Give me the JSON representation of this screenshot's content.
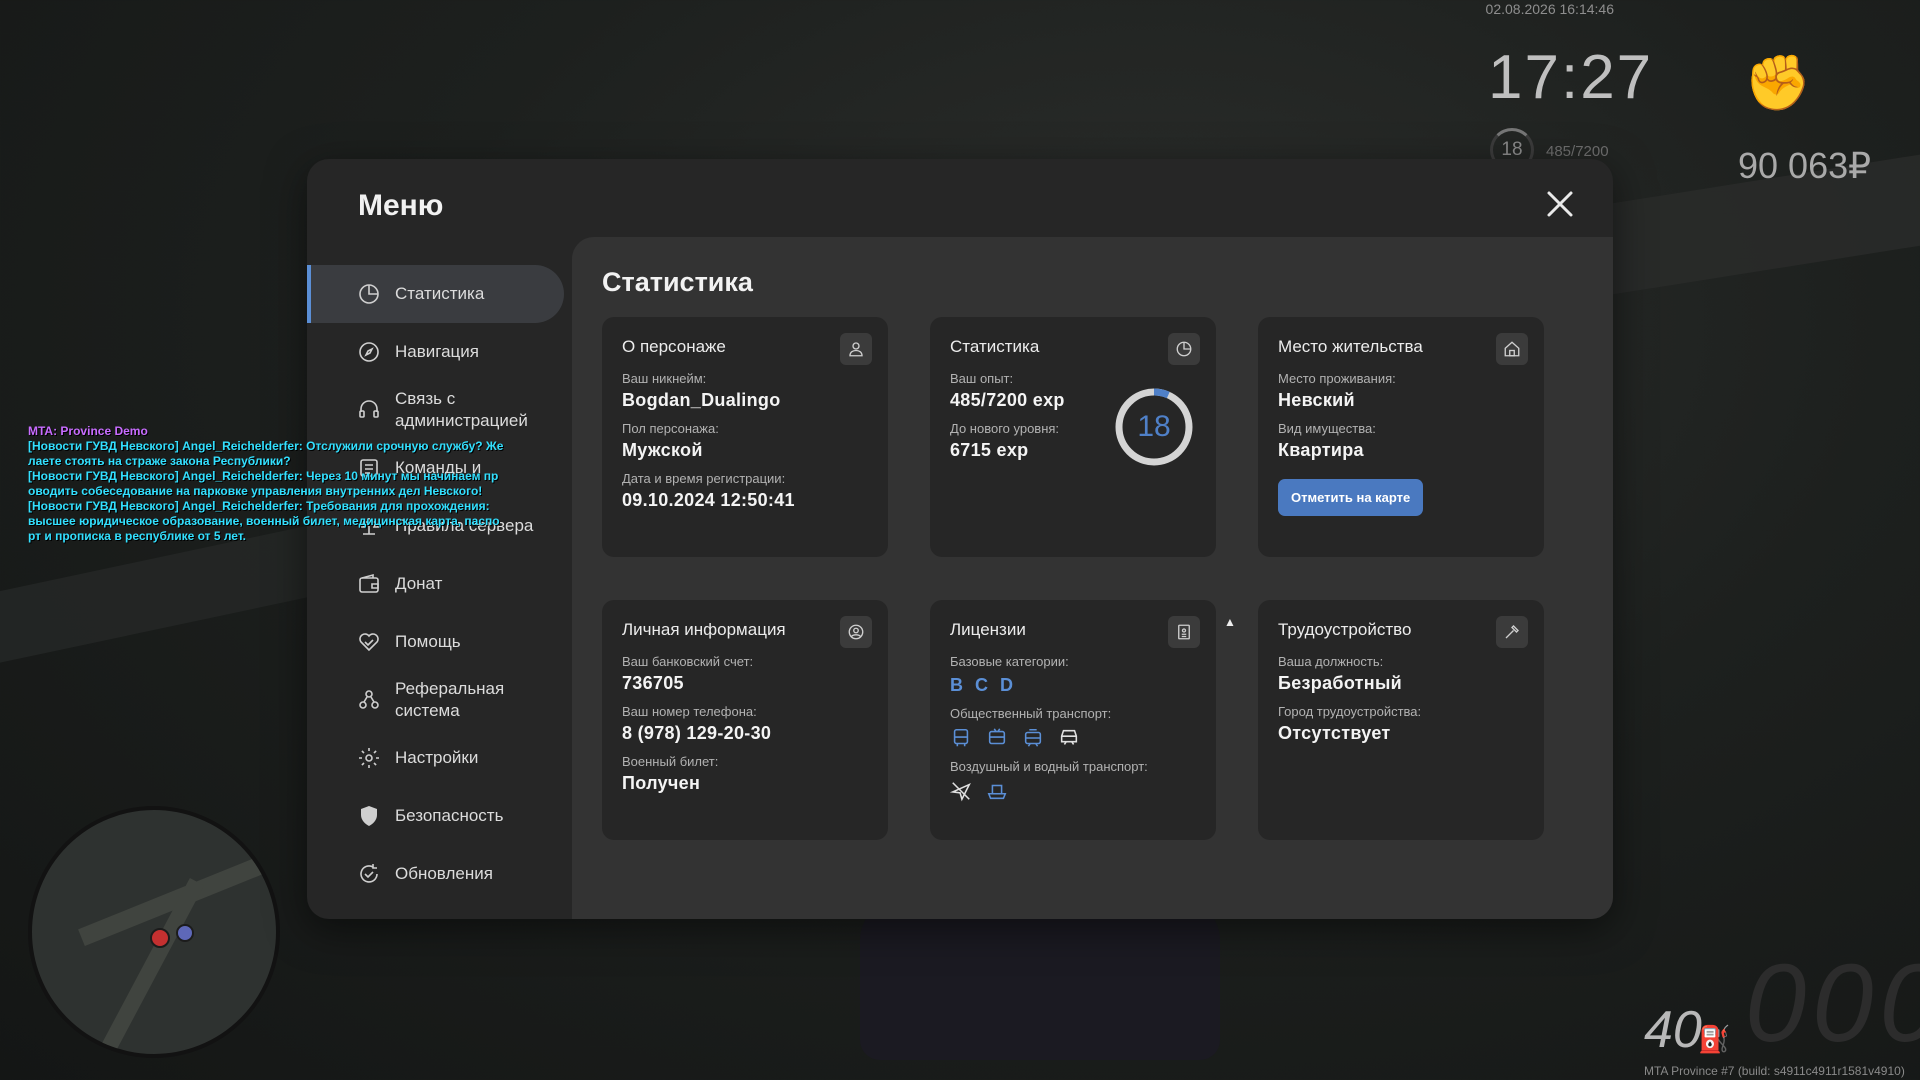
{
  "hud": {
    "datetime": "02.08.2026 16:14:46",
    "time": "17:27",
    "level": "18",
    "exp": "485/7200",
    "money": "90 063₽",
    "speed": "40",
    "build": "MTA Province #7 (build: s4911c4911r1581v4910)"
  },
  "chat": [
    "MTA: Province Demo",
    "[Новости ГУВД Невского] Angel_Reichelderfer: Отслужили срочную службу? Же",
    "лаете стоять на страже закона Республики?",
    "[Новости ГУВД Невского] Angel_Reichelderfer: Через 10 минут мы начинаем пр",
    "оводить собеседование на парковке управления внутренних дел Невского!",
    "[Новости ГУВД Невского] Angel_Reichelderfer: Требования для прохождения:",
    " высшее юридическое образование, военный билет, медицинская карта, паспо",
    "рт и прописка в республике от 5 лет."
  ],
  "menu": {
    "title": "Меню",
    "items": [
      {
        "label": "Статистика"
      },
      {
        "label": "Навигация"
      },
      {
        "label": "Связь с администрацией"
      },
      {
        "label": "Команды и"
      },
      {
        "label": "Правила сервера"
      },
      {
        "label": "Донат"
      },
      {
        "label": "Помощь"
      },
      {
        "label": "Реферальная система"
      },
      {
        "label": "Настройки"
      },
      {
        "label": "Безопасность"
      },
      {
        "label": "Обновления"
      }
    ]
  },
  "content": {
    "title": "Статистика",
    "character": {
      "title": "О персонаже",
      "nick_label": "Ваш никнейм:",
      "nick": "Bogdan_Dualingo",
      "gender_label": "Пол персонажа:",
      "gender": "Мужской",
      "reg_label": "Дата и время регистрации:",
      "reg": "09.10.2024 12:50:41"
    },
    "stats": {
      "title": "Статистика",
      "exp_label": "Ваш опыт:",
      "exp": "485/7200 exp",
      "next_label": "До нового уровня:",
      "next": "6715 exp",
      "level": "18",
      "progress": 0.067
    },
    "residence": {
      "title": "Место жительства",
      "place_label": "Место проживания:",
      "place": "Невский",
      "type_label": "Вид имущества:",
      "type": "Квартира",
      "button": "Отметить на карте"
    },
    "personal": {
      "title": "Личная информация",
      "bank_label": "Ваш банковский счет:",
      "bank": "736705",
      "phone_label": "Ваш номер телефона:",
      "phone": "8 (978) 129-20-30",
      "military_label": "Военный билет:",
      "military": "Получен"
    },
    "licenses": {
      "title": "Лицензии",
      "basic_label": "Базовые категории:",
      "categories": [
        "B",
        "C",
        "D"
      ],
      "public_label": "Общественный транспорт:",
      "air_label": "Воздушный и водный транспорт:"
    },
    "employment": {
      "title": "Трудоустройство",
      "position_label": "Ваша должность:",
      "position": "Безработный",
      "city_label": "Город трудоустройства:",
      "city": "Отсутствует"
    }
  },
  "colors": {
    "accent": "#4a79c0",
    "active_bar": "#5b8fd6"
  }
}
